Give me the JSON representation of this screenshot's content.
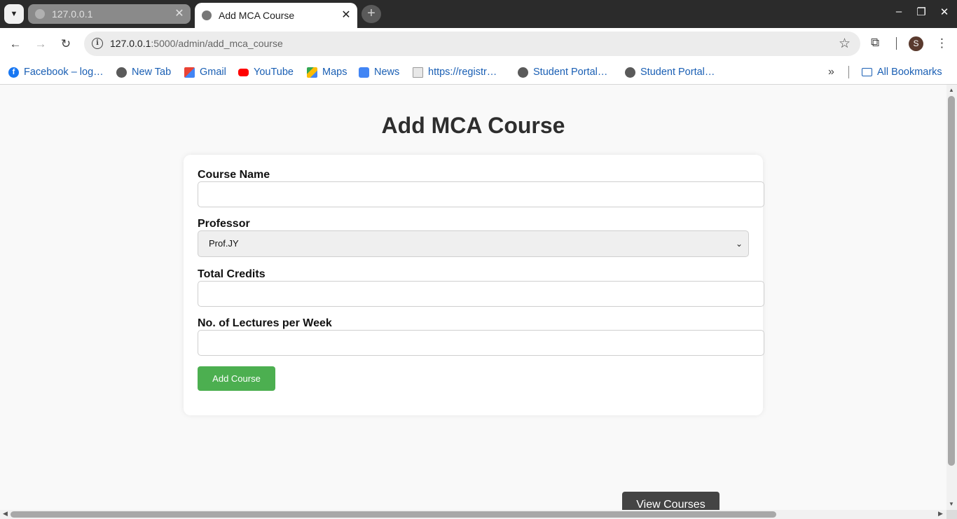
{
  "browser": {
    "tabs": [
      {
        "title": "127.0.0.1",
        "active": false
      },
      {
        "title": "Add MCA Course",
        "active": true
      }
    ],
    "new_tab_label": "+",
    "close_glyph": "✕",
    "address": {
      "host": "127.0.0.1",
      "path": ":5000/admin/add_mca_course"
    },
    "profile_initial": "S",
    "bookmarks": [
      {
        "label": "Facebook – log…",
        "icon": "facebook-icon"
      },
      {
        "label": "New Tab",
        "icon": "globe-icon"
      },
      {
        "label": "Gmail",
        "icon": "gmail-icon"
      },
      {
        "label": "YouTube",
        "icon": "youtube-icon"
      },
      {
        "label": "Maps",
        "icon": "maps-icon"
      },
      {
        "label": "News",
        "icon": "news-icon"
      },
      {
        "label": "https://registr…",
        "icon": "document-icon"
      },
      {
        "label": "Student Portal…",
        "icon": "globe-icon"
      },
      {
        "label": "Student Portal…",
        "icon": "globe-icon"
      }
    ],
    "all_bookmarks_label": "All Bookmarks"
  },
  "page": {
    "title": "Add MCA Course",
    "form": {
      "course_name_label": "Course Name",
      "course_name_value": "",
      "professor_label": "Professor",
      "professor_selected": "Prof.JY",
      "total_credits_label": "Total Credits",
      "total_credits_value": "",
      "lectures_label": "No. of Lectures per Week",
      "lectures_value": "",
      "submit_label": "Add Course"
    },
    "view_courses_label": "View Courses"
  },
  "colors": {
    "submit_button": "#4caf50",
    "view_button": "#444444",
    "page_background": "#f9f9f9",
    "link": "#1a5fb4"
  }
}
